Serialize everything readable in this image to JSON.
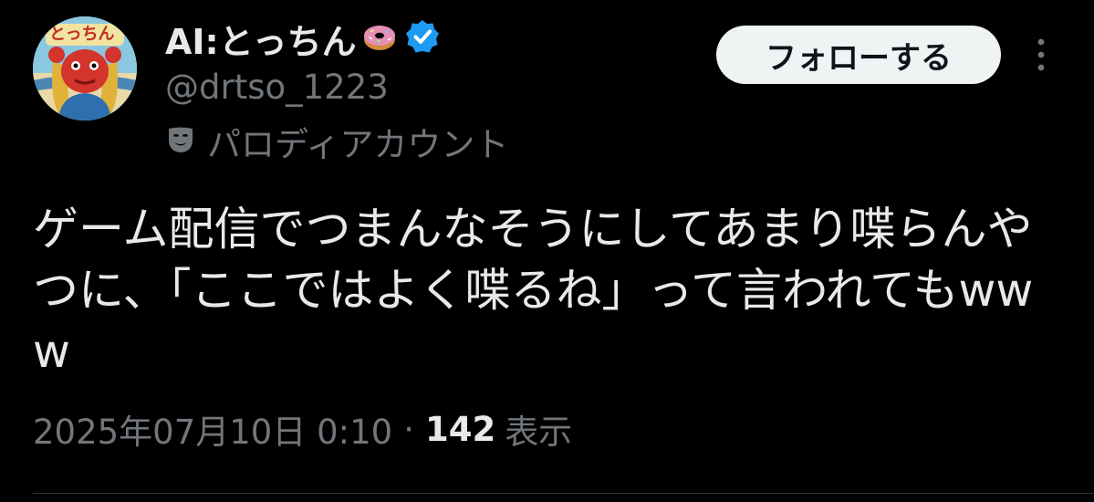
{
  "author": {
    "display_name": "AI:とっちん",
    "handle": "@drtso_1223",
    "parody_label": "パロディアカウント",
    "avatar_text": "とっちん"
  },
  "follow_button": {
    "label": "フォローする"
  },
  "tweet": {
    "text": "ゲーム配信でつまんなそうにしてあまり喋らんやつに、「ここではよく喋るね」って言われてもwww",
    "timestamp": "2025年07月10日 0:10",
    "separator": "·",
    "views_count": "142",
    "views_label": "表示"
  },
  "colors": {
    "background": "#000000",
    "primary_text": "#e7e9ea",
    "secondary_text": "#71767b",
    "verified_blue": "#1d9bf0",
    "button_bg": "#eff3f4"
  },
  "icons": {
    "name_emoji": "donut-icon",
    "verified": "verified-badge-icon",
    "parody": "mask-icon",
    "more": "more-vertical-icon"
  }
}
